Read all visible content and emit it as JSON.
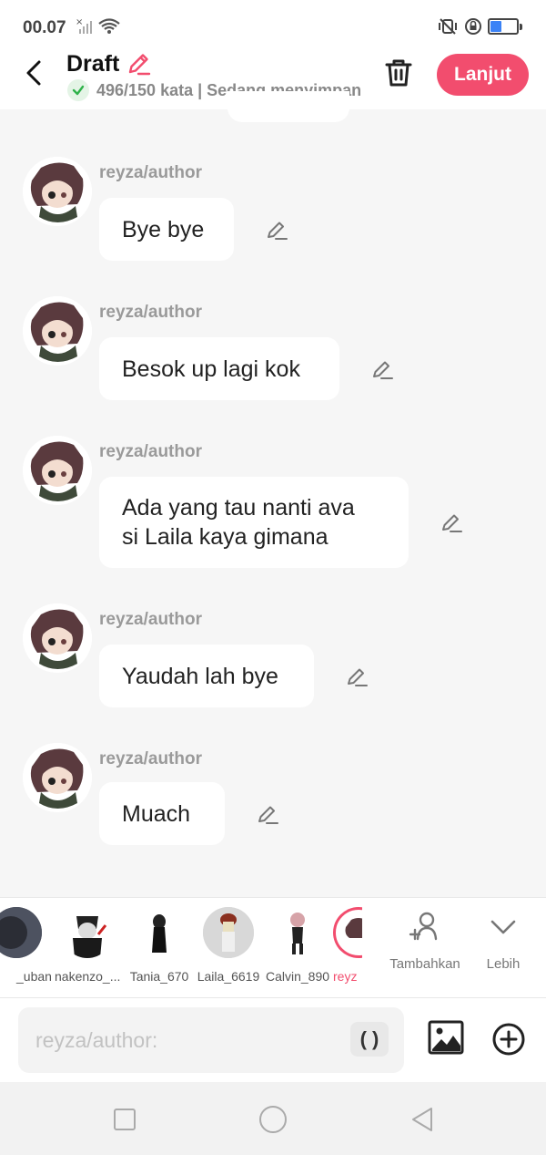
{
  "status_bar": {
    "time": "00.07"
  },
  "header": {
    "title": "Draft",
    "subtext": "496/150 kata | Sedang menyimpan",
    "next_label": "Lanjut"
  },
  "messages": [
    {
      "author": "reyza/author",
      "text": "Bye bye"
    },
    {
      "author": "reyza/author",
      "text": "Besok up lagi kok"
    },
    {
      "author": "reyza/author",
      "line1": "Ada yang tau nanti ava",
      "line2": "si Laila kaya gimana"
    },
    {
      "author": "reyza/author",
      "text": "Yaudah lah bye"
    },
    {
      "author": "reyza/author",
      "text": "Muach"
    }
  ],
  "characters": [
    {
      "name": "_uban"
    },
    {
      "name": "nakenzo_..."
    },
    {
      "name": "Tania_670"
    },
    {
      "name": "Laila_6619"
    },
    {
      "name": "Calvin_890"
    },
    {
      "name": "reyz"
    }
  ],
  "char_actions": {
    "add_label": "Tambahkan",
    "more_label": "Lebih"
  },
  "input": {
    "placeholder": "reyza/author:",
    "paren_label": "( )"
  },
  "colors": {
    "accent": "#f24d6e",
    "check": "#2fb24a"
  }
}
